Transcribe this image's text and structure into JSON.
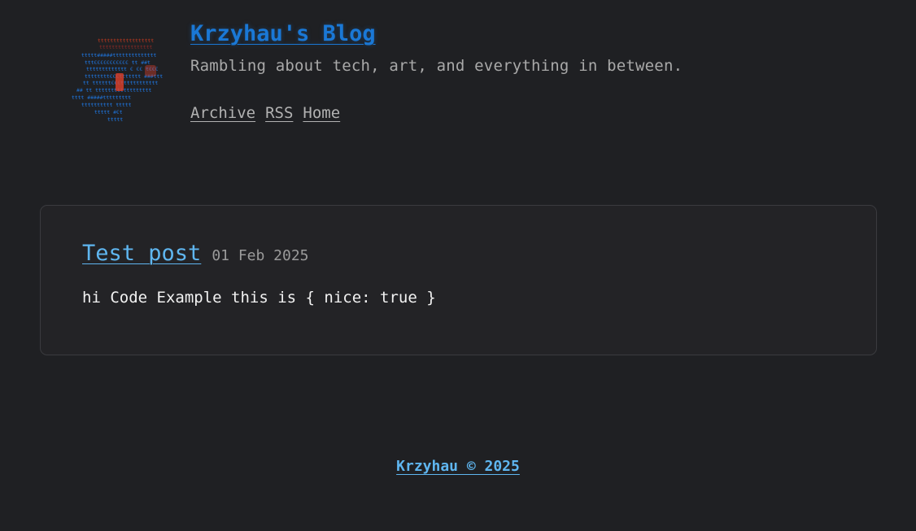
{
  "header": {
    "logo_icon": "ascii-art-avatar-icon",
    "title": "Krzyhau's Blog",
    "tagline": "Rambling about tech, art, and everything in between.",
    "nav": [
      {
        "label": "Archive"
      },
      {
        "label": "RSS"
      },
      {
        "label": "Home"
      }
    ]
  },
  "post": {
    "title": "Test post",
    "date": "01 Feb 2025",
    "excerpt": "hi Code Example this is { nice: true }"
  },
  "footer": {
    "text": "Krzyhau © 2025"
  },
  "colors": {
    "background": "#1f2023",
    "title_blue": "#1a78d6",
    "link_blue": "#5fb6f0",
    "muted_text": "#a9a9a9"
  }
}
